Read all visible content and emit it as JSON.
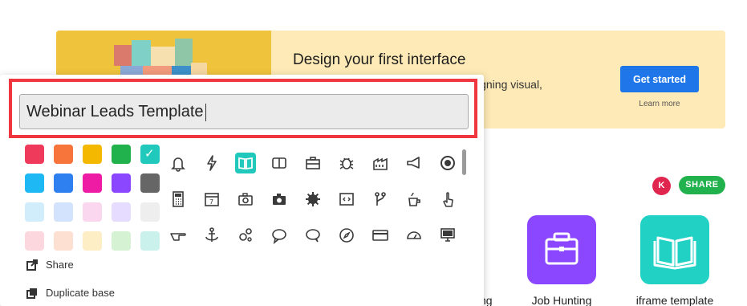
{
  "banner": {
    "title": "Design your first interface",
    "subtitle_partial": "igning visual,",
    "cta_label": "Get started",
    "learn_more": "Learn more"
  },
  "collab": {
    "avatar_initial": "K",
    "share_label": "SHARE"
  },
  "apps": {
    "partial_label": "ng",
    "job_hunting": "Job Hunting",
    "iframe_template": "iframe template"
  },
  "popup": {
    "name_value": "Webinar Leads Template",
    "menu": {
      "share": "Share",
      "duplicate": "Duplicate base"
    }
  },
  "colors": {
    "swatches": [
      [
        "#f03a5b",
        "#f7743a",
        "#f5b800",
        "#21b14d",
        "#21c9bd"
      ],
      [
        "#1eb8f5",
        "#2e7ff0",
        "#ee1ca5",
        "#8b46ff",
        "#666666"
      ],
      [
        "#d1ecfb",
        "#d3e2fd",
        "#fbd7ef",
        "#e6dcff",
        "#eeeeee"
      ],
      [
        "#fcd8de",
        "#fde0d2",
        "#fdeec5",
        "#d5f2d2",
        "#cbf1ec"
      ]
    ],
    "selected": "#21c9bd",
    "accent_blue": "#1e76e8",
    "highlight_red": "#f0363e"
  },
  "icons": [
    [
      "bell-icon",
      "lightning-icon",
      "book-icon",
      "columns-icon",
      "briefcase-icon",
      "bug-icon",
      "factory-icon",
      "megaphone-icon",
      "target-icon"
    ],
    [
      "calculator-icon",
      "calendar-icon",
      "camera-icon",
      "camera-alt-icon",
      "gear-badge-icon",
      "code-icon",
      "git-branch-icon",
      "coffee-icon",
      "hand-pointer-icon"
    ],
    [
      "hand-point-right-icon",
      "anchor-icon",
      "gears-icon",
      "chat-bubble-icon",
      "chat-bubbles-icon",
      "compass-icon",
      "credit-card-icon",
      "dashboard-icon",
      "monitor-icon"
    ]
  ]
}
